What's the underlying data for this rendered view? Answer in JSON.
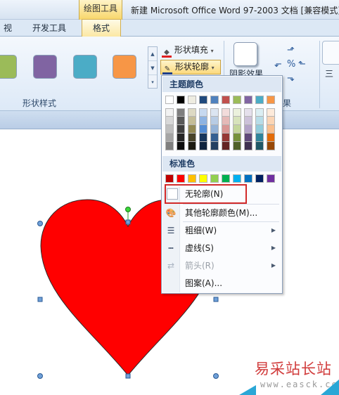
{
  "window": {
    "context_tab_label": "绘图工具",
    "title": "新建 Microsoft Office Word 97-2003 文档 [兼容模式]"
  },
  "tabs": [
    {
      "label": "视图"
    },
    {
      "label": "开发工具"
    },
    {
      "label": "格式"
    }
  ],
  "ribbon": {
    "shape_styles_group_label": "形状样式",
    "swatch_colors": [
      "#9bbb59",
      "#8064a2",
      "#4bacc6",
      "#f79646"
    ],
    "shape_fill_label": "形状填充",
    "shape_outline_label": "形状轮廓",
    "shadow_effect_label": "阴影效果",
    "effects_group_label_partial": "果",
    "threed_label_partial": "三"
  },
  "outline_menu": {
    "theme_colors_header": "主题颜色",
    "theme_colors_top": [
      "#ffffff",
      "#000000",
      "#eeece1",
      "#1f497d",
      "#4f81bd",
      "#c0504d",
      "#9bbb59",
      "#8064a2",
      "#4bacc6",
      "#f79646"
    ],
    "theme_colors_shades": [
      [
        "#f2f2f2",
        "#7f7f7f",
        "#ddd9c3",
        "#c6d9f0",
        "#dbe5f1",
        "#f2dcdb",
        "#ebf1dd",
        "#e5e0ec",
        "#dbeef3",
        "#fdeada"
      ],
      [
        "#d8d8d8",
        "#595959",
        "#c4bd97",
        "#8db3e2",
        "#b8cce4",
        "#e5b9b7",
        "#d7e3bc",
        "#ccc1d9",
        "#b7dde8",
        "#fbd5b5"
      ],
      [
        "#bfbfbf",
        "#3f3f3f",
        "#938953",
        "#548dd4",
        "#95b3d7",
        "#d99694",
        "#c3d69b",
        "#b2a2c7",
        "#92cddc",
        "#fac08f"
      ],
      [
        "#a5a5a5",
        "#262626",
        "#494429",
        "#17365d",
        "#366092",
        "#953734",
        "#76923c",
        "#5f497a",
        "#31859b",
        "#e36c09"
      ],
      [
        "#7f7f7f",
        "#0c0c0c",
        "#1d1b10",
        "#0f243e",
        "#244061",
        "#632423",
        "#4f6128",
        "#3f3151",
        "#205867",
        "#974806"
      ]
    ],
    "standard_colors_header": "标准色",
    "standard_colors": [
      "#c00000",
      "#ff0000",
      "#ffc000",
      "#ffff00",
      "#92d050",
      "#00b050",
      "#00b0f0",
      "#0070c0",
      "#002060",
      "#7030a0"
    ],
    "items": [
      {
        "label": "无轮廓(N)",
        "icon": "empty-swatch-icon"
      },
      {
        "label": "其他轮廓颜色(M)...",
        "icon": "color-palette-icon"
      },
      {
        "label": "粗细(W)",
        "icon": "line-weight-icon"
      },
      {
        "label": "虚线(S)",
        "icon": "dash-style-icon"
      },
      {
        "label": "箭头(R)",
        "icon": "arrow-style-icon"
      },
      {
        "label": "图案(A)...",
        "icon": "pattern-icon"
      }
    ]
  },
  "canvas": {
    "shape": "heart",
    "fill_color": "#ff0000"
  },
  "watermark": {
    "site_name": "易采站长站",
    "url": "www.easck.com"
  }
}
